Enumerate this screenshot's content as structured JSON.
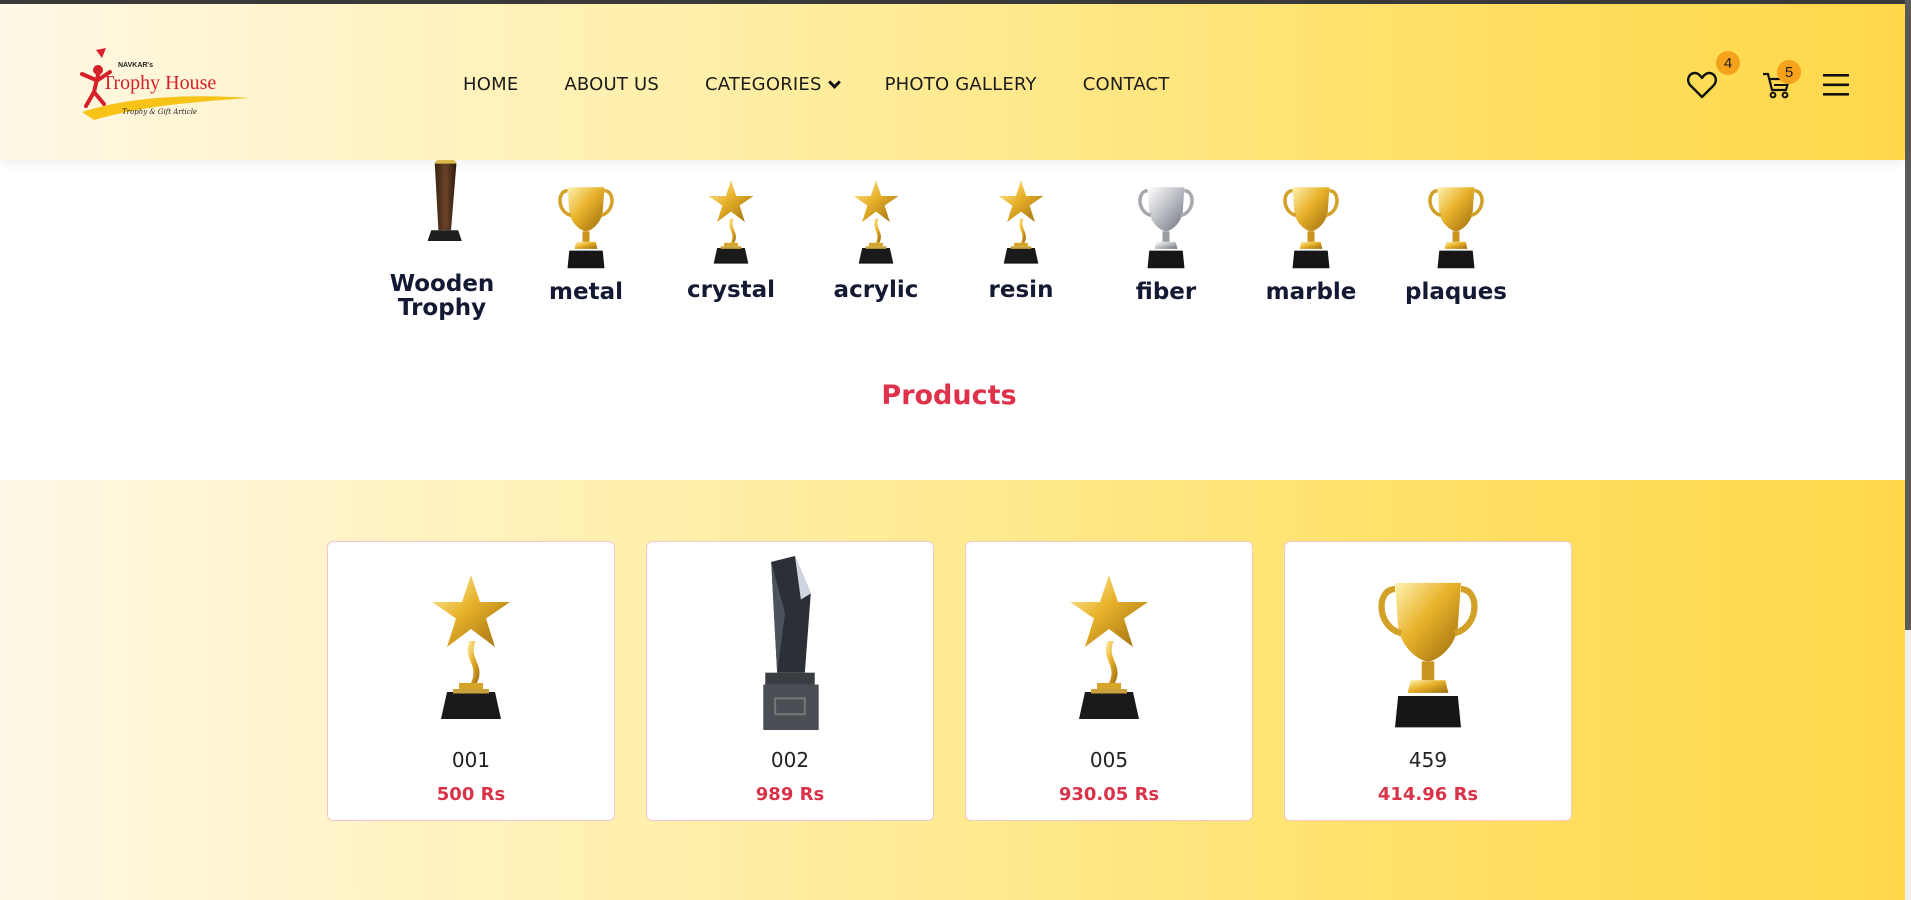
{
  "header": {
    "logo": {
      "top_text": "NAVKAR's",
      "title": "Trophy House",
      "tagline": "Trophy & Gift Article"
    },
    "nav": [
      {
        "label": "HOME"
      },
      {
        "label": "ABOUT US"
      },
      {
        "label": "CATEGORIES"
      },
      {
        "label": "PHOTO GALLERY"
      },
      {
        "label": "CONTACT"
      }
    ],
    "wishlist_count": "4",
    "cart_count": "5",
    "icons": [
      "heart-icon",
      "cart-icon",
      "menu-icon"
    ]
  },
  "categories": [
    {
      "label_line1": "Wooden",
      "label_line2": "Trophy",
      "icon": "wooden-trophy"
    },
    {
      "label": "metal",
      "icon": "gold-cup"
    },
    {
      "label": "crystal",
      "icon": "star-trophy"
    },
    {
      "label": "acrylic",
      "icon": "star-trophy"
    },
    {
      "label": "resin",
      "icon": "star-trophy"
    },
    {
      "label": "fiber",
      "icon": "silver-cup"
    },
    {
      "label": "marble",
      "icon": "gold-cup"
    },
    {
      "label": "plaques",
      "icon": "gold-cup"
    }
  ],
  "products": {
    "title": "Products",
    "items": [
      {
        "name": "001",
        "price": "500 Rs",
        "icon": "star-trophy"
      },
      {
        "name": "002",
        "price": "989 Rs",
        "icon": "crystal-tower"
      },
      {
        "name": "005",
        "price": "930.05 Rs",
        "icon": "star-trophy"
      },
      {
        "name": "459",
        "price": "414.96 Rs",
        "icon": "gold-cup"
      }
    ]
  },
  "colors": {
    "accent_red": "#e0314b",
    "badge_orange": "#f7a21b",
    "gold": "#e2a81e",
    "navy": "#141a33"
  }
}
